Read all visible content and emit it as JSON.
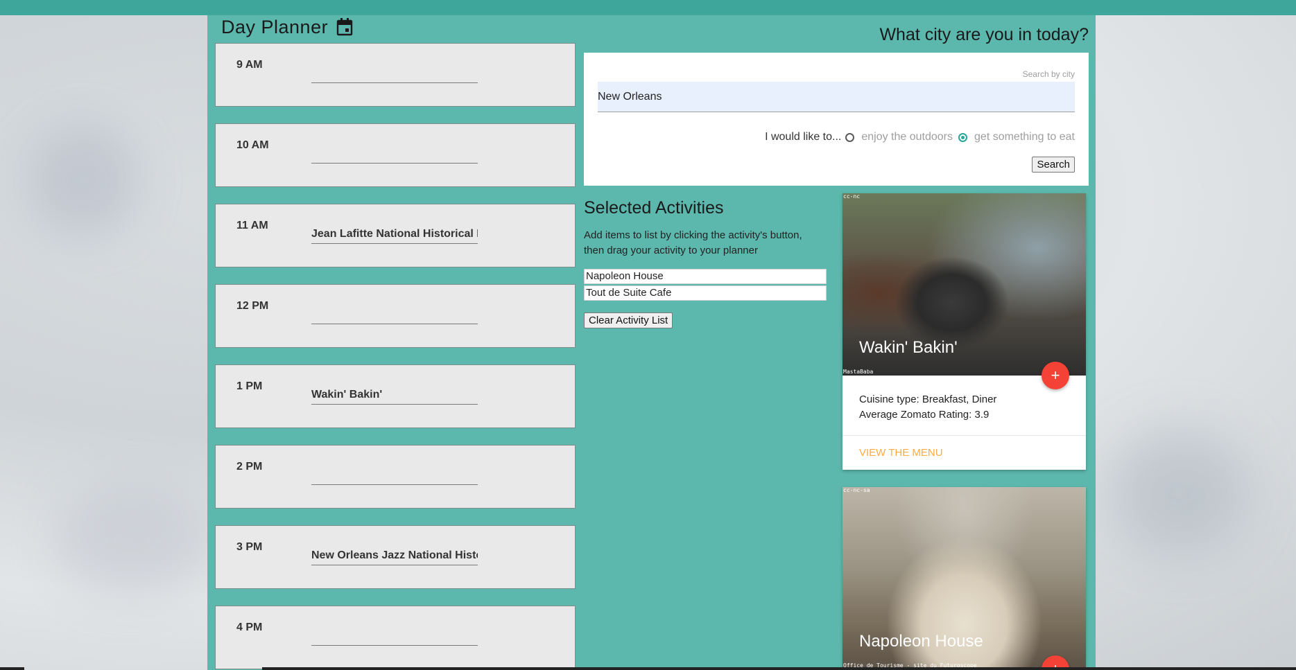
{
  "planner": {
    "title": "Day Planner",
    "slots": [
      {
        "hour": "9 AM",
        "entry": ""
      },
      {
        "hour": "10 AM",
        "entry": ""
      },
      {
        "hour": "11 AM",
        "entry": "Jean Lafitte National Historical Park"
      },
      {
        "hour": "12 PM",
        "entry": ""
      },
      {
        "hour": "1 PM",
        "entry": "Wakin' Bakin'"
      },
      {
        "hour": "2 PM",
        "entry": ""
      },
      {
        "hour": "3 PM",
        "entry": "New Orleans Jazz National Historical Park"
      },
      {
        "hour": "4 PM",
        "entry": ""
      }
    ]
  },
  "search": {
    "question": "What city are you in today?",
    "label": "Search by city",
    "value": "New Orleans",
    "prompt": "I would like to...",
    "options": [
      "enjoy the outdoors",
      "get something to eat"
    ],
    "selected_option": "get something to eat",
    "button": "Search"
  },
  "selected": {
    "title": "Selected Activities",
    "description": "Add items to list by clicking the activity's button, then drag your activity to your planner",
    "items": [
      "Napoleon House",
      "Tout de Suite Cafe"
    ],
    "clear_button": "Clear Activity List"
  },
  "cards": [
    {
      "title": "Wakin' Bakin'",
      "license": "cc-nc",
      "credit": "MastaBaba",
      "cuisine": "Cuisine type: Breakfast, Diner",
      "rating": "Average Zomato Rating: 3.9",
      "action": "View the menu",
      "add": "+"
    },
    {
      "title": "Napoleon House",
      "license": "cc-nc-sa",
      "credit": "Office de Tourisme - site du Futuroscope",
      "add": "+"
    }
  ],
  "colors": {
    "main_bg": "#5cb7ad",
    "top_bar": "#3fa69b",
    "fab": "#f44336",
    "link": "#ffab40",
    "radio_checked": "#26a69a"
  }
}
